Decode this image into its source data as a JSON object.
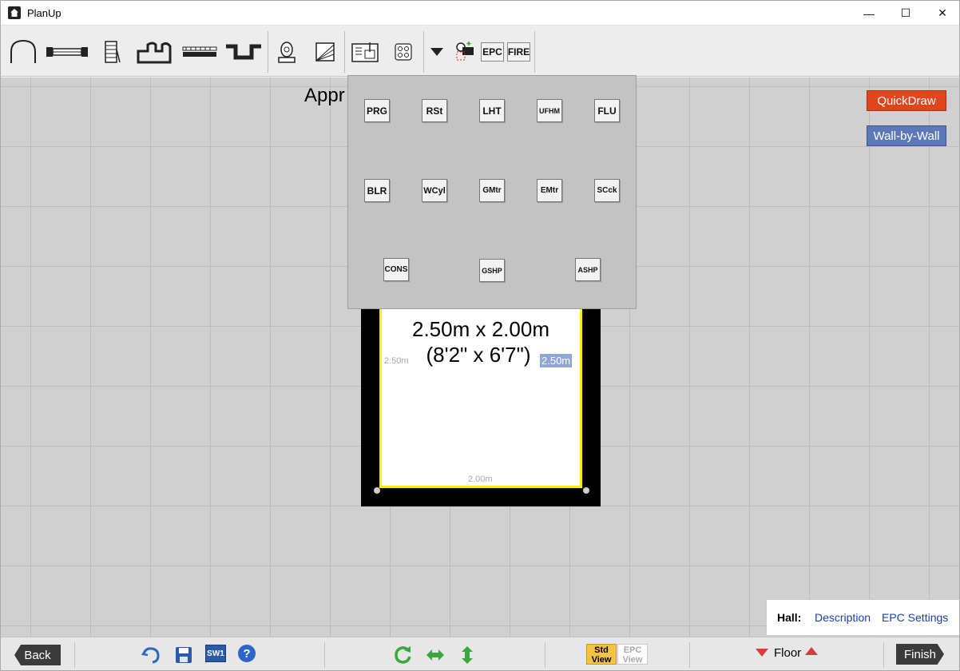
{
  "window": {
    "title": "PlanUp",
    "minimize": "—",
    "maximize": "☐",
    "close": "✕"
  },
  "toolbar": {
    "icons": [
      "door-arc-icon",
      "window-icon",
      "stairs-icon",
      "opening-icon",
      "radiator-icon",
      "recess-icon",
      "boiler-icon",
      "shading-icon",
      "insert-item-icon",
      "grid-items-icon",
      "dropdown-arrow-icon",
      "add-object-icon"
    ],
    "epc_label": "EPC",
    "fire_label": "FIRE"
  },
  "canvas": {
    "approx_text_start": "Appr",
    "approx_text_end": ")",
    "room": {
      "size_metric": "2.50m x 2.00m",
      "size_imperial": "(8'2\" x 6'7\")",
      "dim_left": "2.50m",
      "dim_right": "2.50m",
      "dim_bottom": "2.00m"
    }
  },
  "dropdown_panel": {
    "row1": [
      "PRG",
      "RSt",
      "LHT",
      "UFHM",
      "FLU"
    ],
    "row2": [
      "BLR",
      "WCyl",
      "GMtr",
      "EMtr",
      "SCck"
    ],
    "row3": [
      "CONS",
      "GSHP",
      "ASHP"
    ]
  },
  "side_buttons": {
    "quickdraw": "QuickDraw",
    "wall_by_wall": "Wall-by-Wall"
  },
  "hall_panel": {
    "label": "Hall:",
    "description_link": "Description",
    "epc_settings_link": "EPC Settings"
  },
  "bottombar": {
    "back_label": "Back",
    "sw1_label": "SW1",
    "help_label": "?",
    "std_view_line1": "Std",
    "std_view_line2": "View",
    "epc_view_line1": "EPC",
    "epc_view_line2": "View",
    "floor_label": "Floor",
    "finish_label": "Finish"
  },
  "colors": {
    "quickdraw": "#e0461e",
    "wall_by_wall": "#5c78b8",
    "room_border": "#ffee00",
    "link": "#1a3fa8",
    "std_view": "#f5c342",
    "floor_arrows": "#d63e3e"
  }
}
